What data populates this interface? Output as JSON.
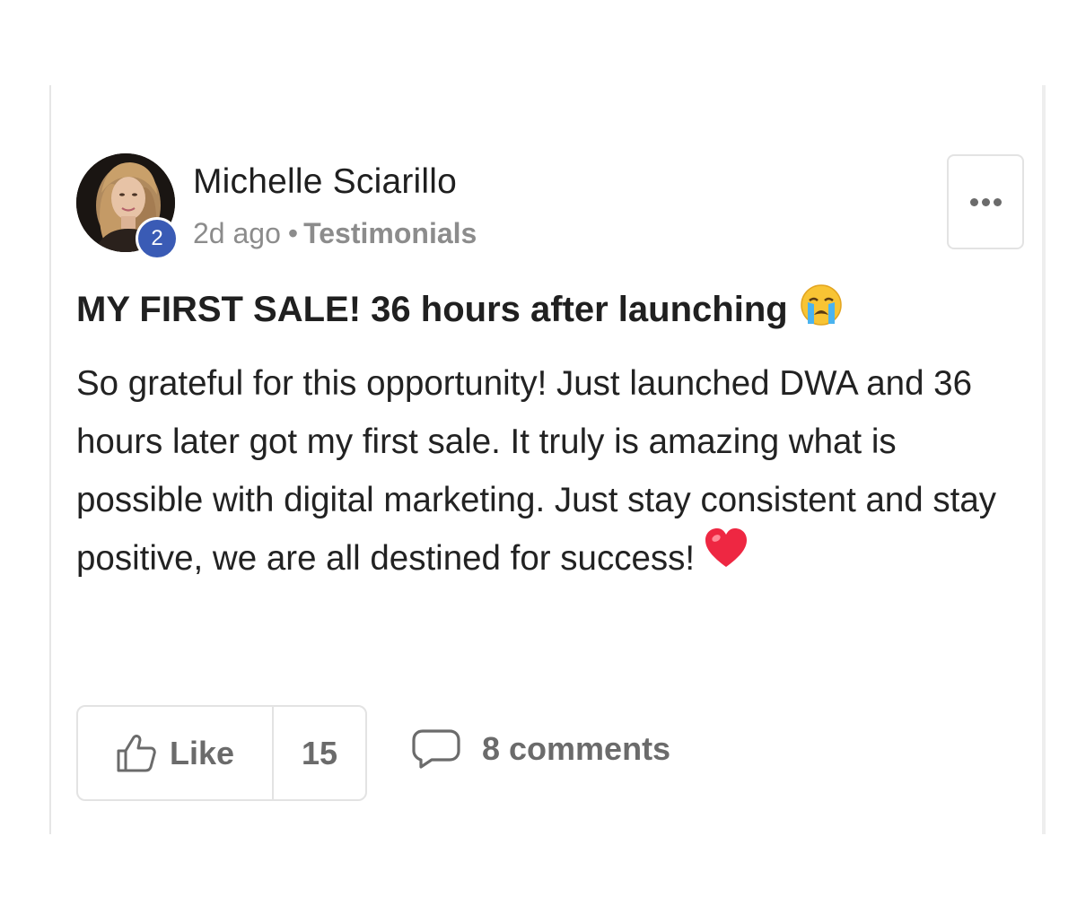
{
  "post": {
    "author": {
      "name": "Michelle Sciarillo",
      "level": "2",
      "level_badge_color": "#3a5bb5"
    },
    "meta": {
      "time": "2d ago",
      "separator": "•",
      "category": "Testimonials"
    },
    "title": "MY FIRST SALE! 36 hours after launching",
    "title_emoji": "crying-face-emoji",
    "body": "So grateful for this opportunity! Just launched DWA and 36 hours later got my first sale. It truly is amazing what is possible with digital marketing. Just stay consistent and stay positive, we are all destined for success!",
    "body_emoji": "red-heart-emoji",
    "actions": {
      "like_label": "Like",
      "like_count": "15",
      "comments_label": "8 comments"
    }
  },
  "icons": {
    "more": "more-options-icon",
    "like": "thumbs-up-icon",
    "comments": "speech-bubble-icon"
  },
  "colors": {
    "text": "#1f1f1f",
    "muted": "#8c8c8c",
    "action": "#6b6b6b",
    "border": "#e3e3e3"
  }
}
